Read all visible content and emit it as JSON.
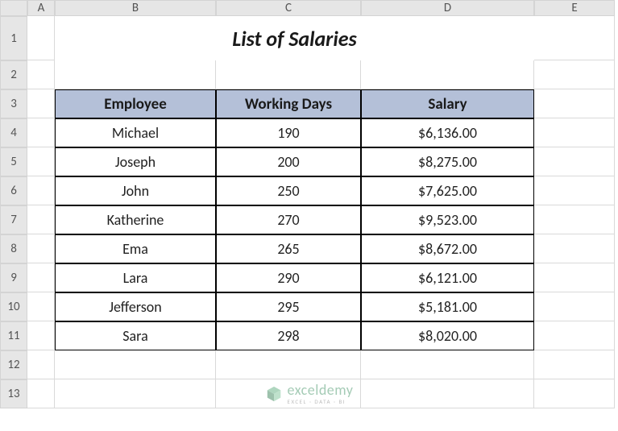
{
  "columns": [
    "A",
    "B",
    "C",
    "D",
    "E"
  ],
  "rows": [
    "1",
    "2",
    "3",
    "4",
    "5",
    "6",
    "7",
    "8",
    "9",
    "10",
    "11",
    "12",
    "13"
  ],
  "title": "List of Salaries",
  "headers": {
    "employee": "Employee",
    "working_days": "Working Days",
    "salary": "Salary"
  },
  "data": [
    {
      "employee": "Michael",
      "working_days": "190",
      "salary": "$6,136.00"
    },
    {
      "employee": "Joseph",
      "working_days": "200",
      "salary": "$8,275.00"
    },
    {
      "employee": "John",
      "working_days": "250",
      "salary": "$7,625.00"
    },
    {
      "employee": "Katherine",
      "working_days": "270",
      "salary": "$9,523.00"
    },
    {
      "employee": "Ema",
      "working_days": "265",
      "salary": "$8,672.00"
    },
    {
      "employee": "Lara",
      "working_days": "290",
      "salary": "$6,121.00"
    },
    {
      "employee": "Jefferson",
      "working_days": "295",
      "salary": "$5,181.00"
    },
    {
      "employee": "Sara",
      "working_days": "298",
      "salary": "$8,020.00"
    }
  ],
  "watermark": {
    "main": "exceldemy",
    "sub": "EXCEL · DATA · BI"
  },
  "chart_data": {
    "type": "table",
    "title": "List of Salaries",
    "columns": [
      "Employee",
      "Working Days",
      "Salary"
    ],
    "rows": [
      [
        "Michael",
        190,
        6136.0
      ],
      [
        "Joseph",
        200,
        8275.0
      ],
      [
        "John",
        250,
        7625.0
      ],
      [
        "Katherine",
        270,
        9523.0
      ],
      [
        "Ema",
        265,
        8672.0
      ],
      [
        "Lara",
        290,
        6121.0
      ],
      [
        "Jefferson",
        295,
        5181.0
      ],
      [
        "Sara",
        298,
        8020.0
      ]
    ]
  }
}
